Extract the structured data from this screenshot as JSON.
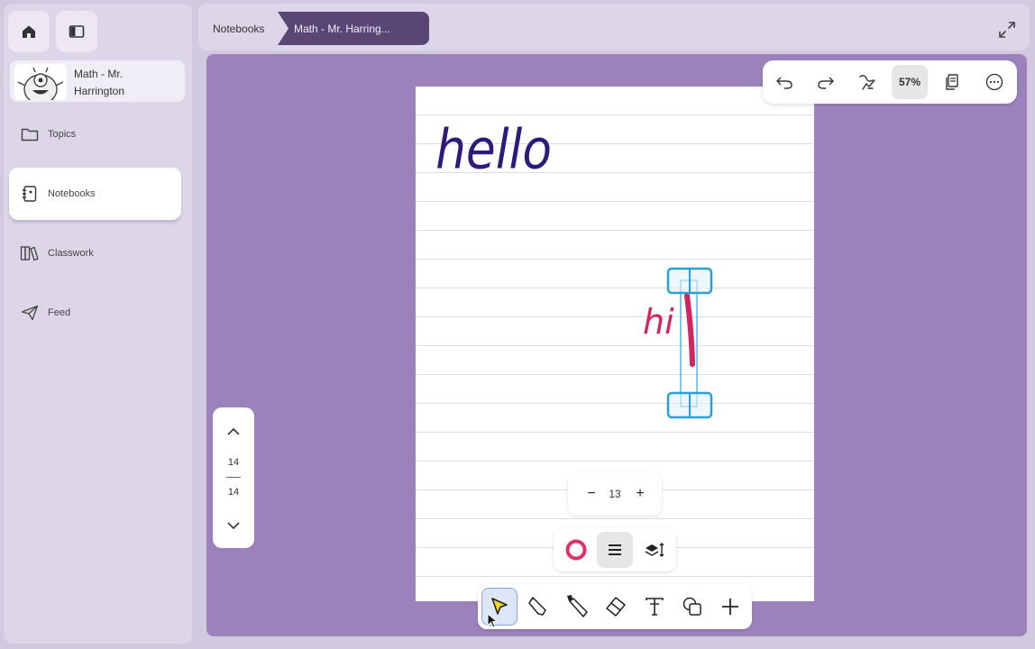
{
  "sidebar": {
    "notebook_name": "Math - Mr. Harrington",
    "nav": [
      {
        "label": "Topics",
        "icon": "folder-icon"
      },
      {
        "label": "Notebooks",
        "icon": "notebook-icon",
        "active": true
      },
      {
        "label": "Classwork",
        "icon": "books-icon"
      },
      {
        "label": "Feed",
        "icon": "send-icon"
      }
    ]
  },
  "breadcrumb": {
    "root": "Notebooks",
    "current": "Math - Mr. Harring..."
  },
  "toolbar": {
    "zoom": "57%"
  },
  "pager": {
    "current": "14",
    "total": "14"
  },
  "stroke_size": {
    "minus": "−",
    "value": "13",
    "plus": "+"
  },
  "canvas": {
    "handwriting_1": "hello",
    "handwriting_2": "hi"
  },
  "colors": {
    "accent": "#5a4674",
    "canvas_bg": "#9b82bd",
    "ink_blue": "#2e1a7a",
    "ink_pink": "#d2245e",
    "selection": "#2a9fd8",
    "pen_color": "#e0306a"
  }
}
